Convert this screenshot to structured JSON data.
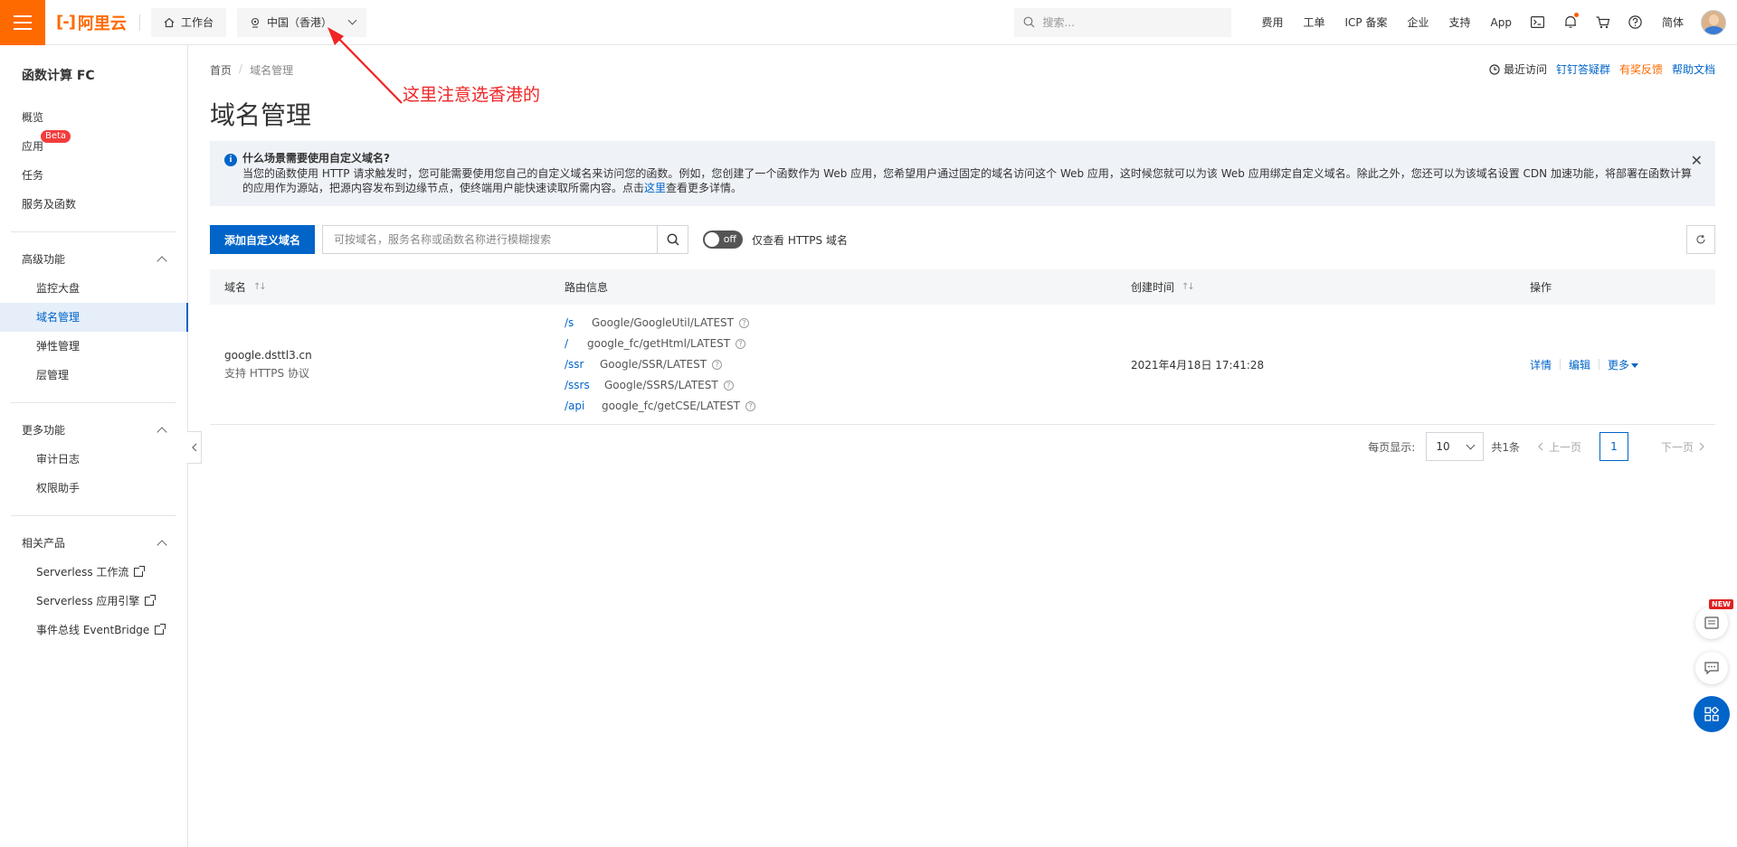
{
  "topbar": {
    "logo_mark": "[-]",
    "logo_text": "阿里云",
    "workbench": "工作台",
    "region": "中国（香港）",
    "search_placeholder": "搜索...",
    "links": [
      "费用",
      "工单",
      "ICP 备案",
      "企业",
      "支持",
      "App"
    ],
    "lang": "简体"
  },
  "sidebar": {
    "title": "函数计算 FC",
    "items": [
      {
        "label": "概览"
      },
      {
        "label": "应用",
        "badge": "Beta"
      },
      {
        "label": "任务"
      },
      {
        "label": "服务及函数"
      }
    ],
    "group_advanced": "高级功能",
    "advanced_items": [
      {
        "label": "监控大盘"
      },
      {
        "label": "域名管理"
      },
      {
        "label": "弹性管理"
      },
      {
        "label": "层管理"
      }
    ],
    "group_more": "更多功能",
    "more_items": [
      {
        "label": "审计日志"
      },
      {
        "label": "权限助手"
      }
    ],
    "group_related": "相关产品",
    "related_items": [
      {
        "label": "Serverless 工作流"
      },
      {
        "label": "Serverless 应用引擎"
      },
      {
        "label": "事件总线 EventBridge"
      }
    ]
  },
  "breadcrumb": {
    "home": "首页",
    "current": "域名管理"
  },
  "header_links": {
    "recent": "最近访问",
    "dingtalk": "钉钉答疑群",
    "feedback": "有奖反馈",
    "docs": "帮助文档"
  },
  "page_title": "域名管理",
  "annotation": "这里注意选香港的",
  "notice": {
    "title": "什么场景需要使用自定义域名?",
    "body_pre": "当您的函数使用 HTTP 请求触发时，您可能需要使用您自己的自定义域名来访问您的函数。例如，您创建了一个函数作为 Web 应用，您希望用户通过固定的域名访问这个 Web 应用，这时候您就可以为该 Web 应用绑定自定义域名。除此之外，您还可以为该域名设置 CDN 加速功能，将部署在函数计算的应用作为源站，把源内容发布到边缘节点，使终端用户能快速读取所需内容。点击",
    "link": "这里",
    "body_post": "查看更多详情。"
  },
  "toolbar": {
    "add_button": "添加自定义域名",
    "search_placeholder": "可按域名，服务名称或函数名称进行模糊搜索",
    "toggle_text": "off",
    "toggle_label": "仅查看 HTTPS 域名"
  },
  "table": {
    "headers": [
      "域名",
      "路由信息",
      "创建时间",
      "操作"
    ],
    "rows": [
      {
        "domain": "google.dsttl3.cn",
        "domain_sub": "支持 HTTPS 协议",
        "routes": [
          {
            "path": "/s",
            "target": "Google/GoogleUtil/LATEST"
          },
          {
            "path": "/",
            "target": "google_fc/getHtml/LATEST"
          },
          {
            "path": "/ssr",
            "target": "Google/SSR/LATEST"
          },
          {
            "path": "/ssrs",
            "target": "Google/SSRS/LATEST"
          },
          {
            "path": "/api",
            "target": "google_fc/getCSE/LATEST"
          }
        ],
        "created": "2021年4月18日 17:41:28",
        "ops": [
          "详情",
          "编辑",
          "更多"
        ]
      }
    ]
  },
  "pagination": {
    "per_page_label": "每页显示:",
    "per_page": "10",
    "total": "共1条",
    "prev": "上一页",
    "current": "1",
    "next": "下一页"
  },
  "floating": {
    "new_badge": "NEW"
  },
  "colors": {
    "brand": "#ff6a00",
    "primary": "#0064c8",
    "annotation": "#f02424"
  }
}
